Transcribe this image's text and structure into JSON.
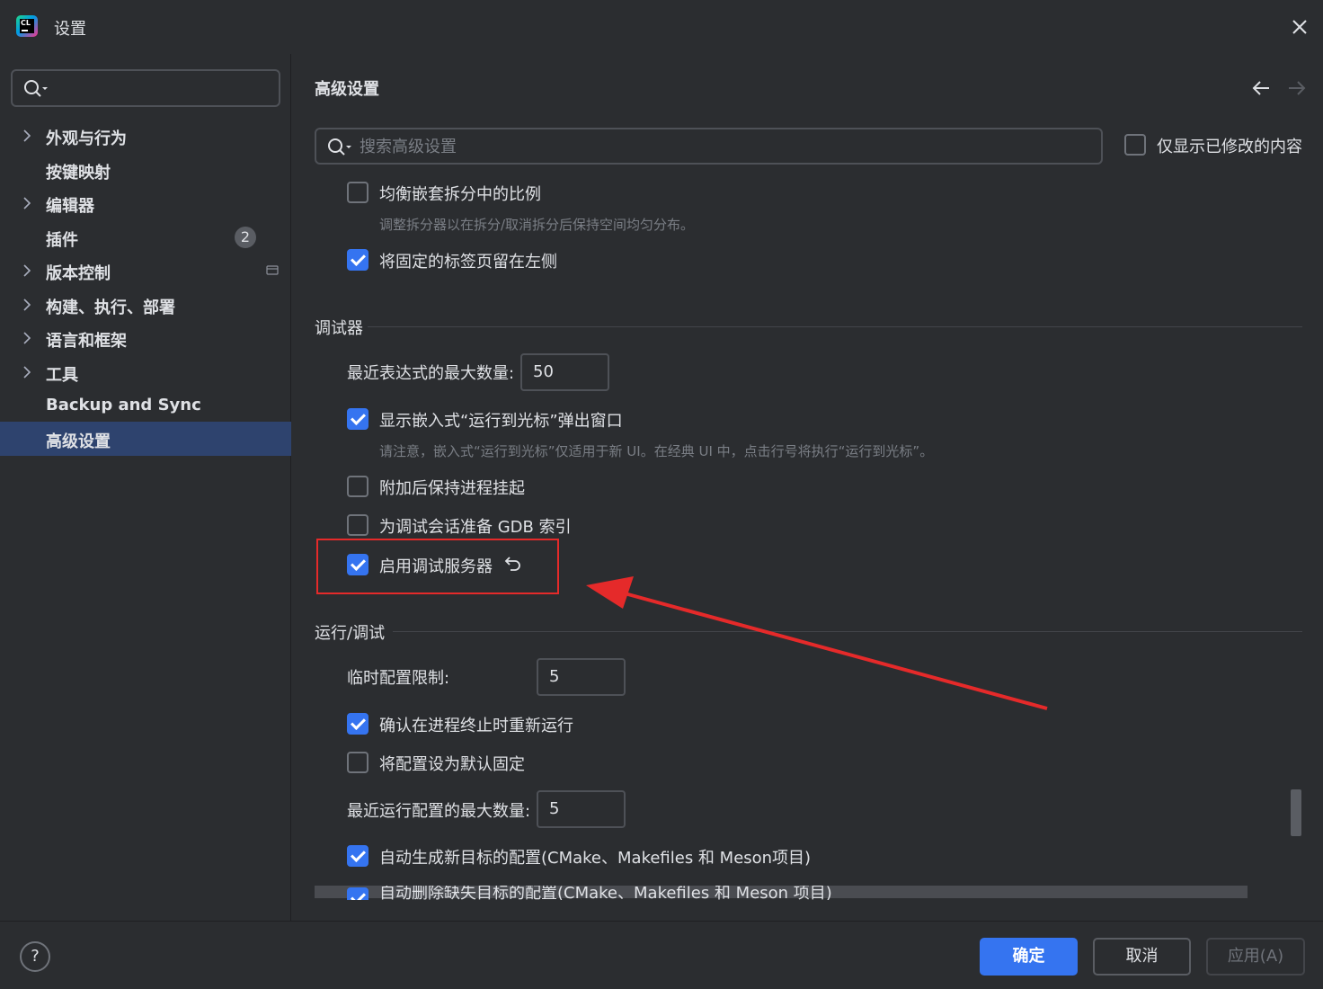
{
  "window": {
    "title": "设置"
  },
  "sidebar": {
    "search_placeholder": "",
    "items": [
      {
        "label": "外观与行为",
        "expandable": true
      },
      {
        "label": "按键映射",
        "expandable": false
      },
      {
        "label": "编辑器",
        "expandable": true
      },
      {
        "label": "插件",
        "expandable": false,
        "badge": "2"
      },
      {
        "label": "版本控制",
        "expandable": true
      },
      {
        "label": "构建、执行、部署",
        "expandable": true
      },
      {
        "label": "语言和框架",
        "expandable": true
      },
      {
        "label": "工具",
        "expandable": true
      },
      {
        "label": "Backup and Sync",
        "expandable": false
      },
      {
        "label": "高级设置",
        "expandable": false,
        "selected": true
      }
    ]
  },
  "main": {
    "title": "高级设置",
    "search_placeholder": "搜索高级设置",
    "show_modified_only": {
      "label": "仅显示已修改的内容",
      "checked": false
    },
    "options_top": [
      {
        "label": "均衡嵌套拆分中的比例",
        "checked": false,
        "hint": "调整拆分器以在拆分/取消拆分后保持空间均匀分布。"
      },
      {
        "label": "将固定的标签页留在左侧",
        "checked": true
      }
    ],
    "debugger": {
      "section_title": "调试器",
      "max_recent_expressions": {
        "label": "最近表达式的最大数量:",
        "value": "50"
      },
      "show_inline_run_to_cursor": {
        "label": "显示嵌入式“运行到光标”弹出窗口",
        "checked": true,
        "hint": "请注意，嵌入式“运行到光标”仅适用于新 UI。在经典 UI 中，点击行号将执行“运行到光标”。"
      },
      "keep_suspended_after_attach": {
        "label": "附加后保持进程挂起",
        "checked": false
      },
      "prepare_gdb_index": {
        "label": "为调试会话准备 GDB 索引",
        "checked": false
      },
      "enable_debug_server": {
        "label": "启用调试服务器",
        "checked": true
      }
    },
    "run_debug": {
      "section_title": "运行/调试",
      "temp_config_limit": {
        "label": "临时配置限制:",
        "value": "5"
      },
      "confirm_rerun": {
        "label": "确认在进程终止时重新运行",
        "checked": true
      },
      "pin_by_default": {
        "label": "将配置设为默认固定",
        "checked": false
      },
      "max_recent_run_configs": {
        "label": "最近运行配置的最大数量:",
        "value": "5"
      },
      "auto_generate_configs": {
        "label": "自动生成新目标的配置(CMake、Makefiles 和 Meson项目)",
        "checked": true
      },
      "auto_delete_configs": {
        "label": "自动删除缺失目标的配置(CMake、Makefiles 和 Meson 项目)",
        "checked": true
      }
    }
  },
  "footer": {
    "help": "?",
    "ok": "确定",
    "cancel": "取消",
    "apply": "应用(A)"
  },
  "colors": {
    "accent": "#3574f0",
    "annotation": "#e52a2a",
    "selection": "#2e436e"
  }
}
